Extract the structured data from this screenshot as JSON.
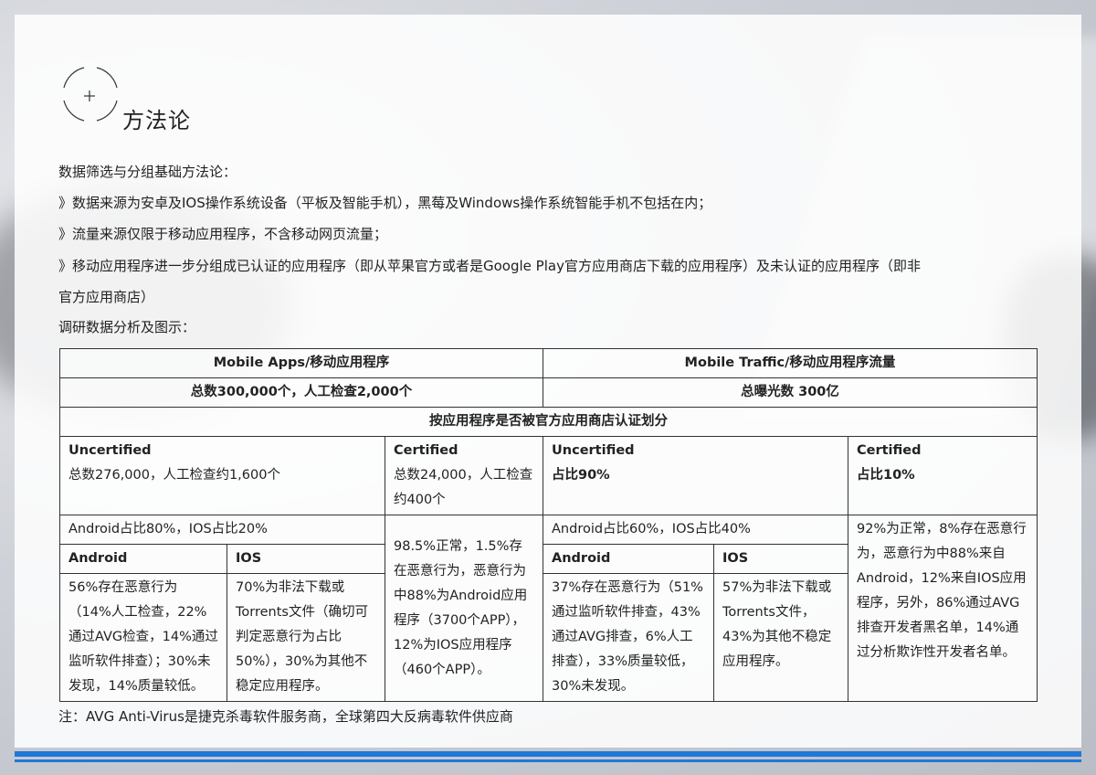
{
  "section_title": "方法论",
  "intro": {
    "heading": "数据筛选与分组基础方法论：",
    "bullets": [
      "》数据来源为安卓及IOS操作系统设备（平板及智能手机），黑莓及Windows操作系统智能手机不包括在内；",
      "》流量来源仅限于移动应用程序，不含移动网页流量；",
      "》移动应用程序进一步分组成已认证的应用程序（即从苹果官方或者是Google Play官方应用商店下载的应用程序）及未认证的应用程序（即非",
      "官方应用商店）"
    ],
    "analysis_heading": "调研数据分析及图示："
  },
  "table": {
    "apps_header": "Mobile Apps/移动应用程序",
    "traffic_header": "Mobile Traffic/移动应用程序流量",
    "apps_total": "总数300,000个，人工检查2,000个",
    "traffic_total": "总曝光数 300亿",
    "group_header": "按应用程序是否被官方应用商店认证划分",
    "apps_uncert_title": "Uncertified",
    "apps_uncert_detail": "总数276,000，人工检查约1,600个",
    "apps_cert_title": "Certified",
    "apps_cert_detail": "总数24,000，人工检查约400个",
    "traffic_uncert_title": "Uncertified",
    "traffic_uncert_detail": "占比90%",
    "traffic_cert_title": "Certified",
    "traffic_cert_detail": "占比10%",
    "apps_split": "Android占比80%，IOS占比20%",
    "traffic_split": "Android占比60%，IOS占比40%",
    "android_label": "Android",
    "ios_label": "IOS",
    "apps_android_text": "56%存在恶意行为（14%人工检查，22%通过AVG检查，14%通过监听软件排查）；30%未发现，14%质量较低。",
    "apps_ios_text": "70%为非法下载或Torrents文件（确切可判定恶意行为占比50%），30%为其他不稳定应用程序。",
    "apps_cert_text": "98.5%正常，1.5%存在恶意行为，恶意行为中88%为Android应用程序（3700个APP），12%为IOS应用程序（460个APP）。",
    "traffic_android_text": "37%存在恶意行为（51%通过监听软件排查，43%通过AVG排查，6%人工排查），33%质量较低，30%未发现。",
    "traffic_ios_text": "57%为非法下载或Torrents文件，43%为其他不稳定应用程序。",
    "traffic_cert_text": "92%为正常，8%存在恶意行为，恶意行为中88%来自Android，12%来自IOS应用程序，另外，86%通过AVG排查开发者黑名单，14%通过分析欺诈性开发者名单。"
  },
  "note": "注：AVG Anti-Virus是捷克杀毒软件服务商，全球第四大反病毒软件供应商",
  "colors": {
    "accent": "#1f78d8",
    "text": "#222222",
    "border": "#333333"
  },
  "icons": [
    "crosshair-circle-icon"
  ]
}
